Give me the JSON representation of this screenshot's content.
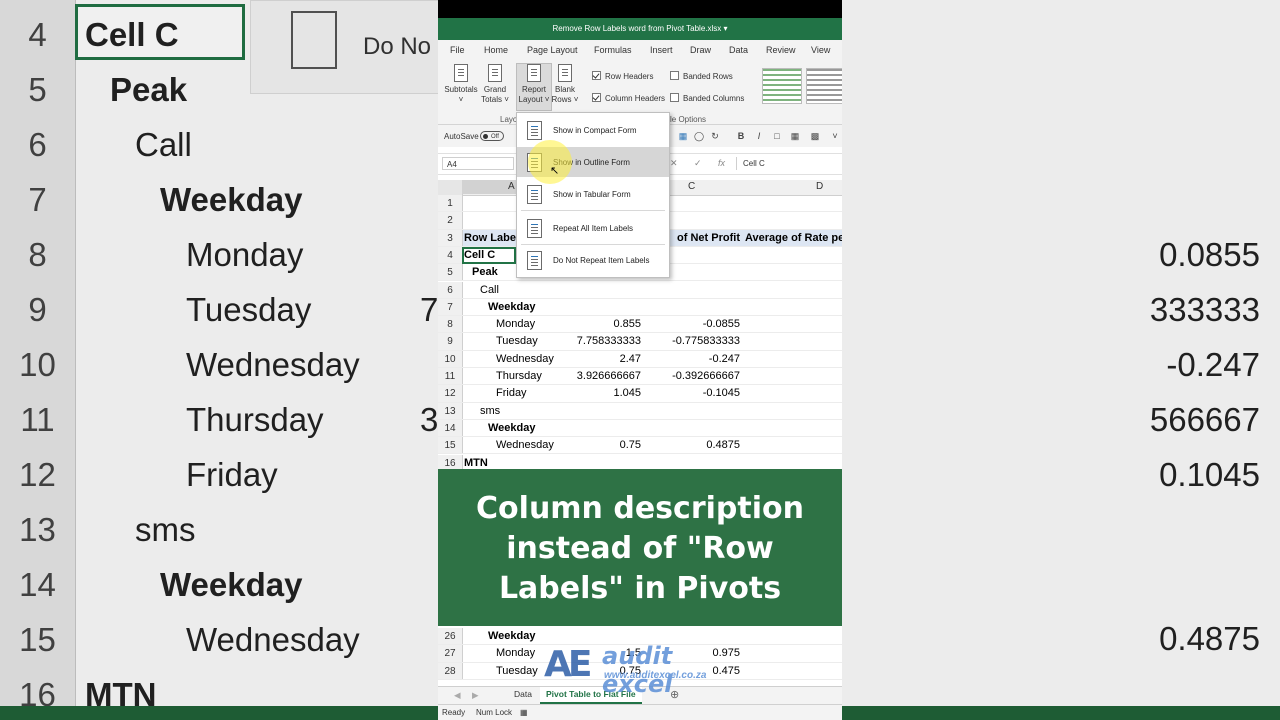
{
  "window": {
    "title": "Remove Row Labels word from Pivot Table.xlsx"
  },
  "menu_tabs": [
    "File",
    "Home",
    "Page Layout",
    "Formulas",
    "Insert",
    "Draw",
    "Data",
    "Review",
    "View"
  ],
  "ribbon": {
    "buttons": [
      {
        "label1": "Subtotals",
        "label2": ""
      },
      {
        "label1": "Grand",
        "label2": "Totals"
      },
      {
        "label1": "Report",
        "label2": "Layout"
      },
      {
        "label1": "Blank",
        "label2": "Rows"
      }
    ],
    "checkboxes": [
      {
        "label": "Row Headers",
        "checked": true
      },
      {
        "label": "Column Headers",
        "checked": true
      },
      {
        "label": "Banded Rows",
        "checked": false
      },
      {
        "label": "Banded Columns",
        "checked": false
      }
    ],
    "group_layout": "Layo",
    "group_style": "yle Options"
  },
  "qat": {
    "autosave_label": "AutoSave",
    "toggle_label": "Off"
  },
  "formula_bar": {
    "name_box": "A4",
    "formula": "Cell C"
  },
  "columns": [
    "A",
    "C",
    "D"
  ],
  "dropdown": {
    "items": [
      {
        "label": "Show in Compact Form"
      },
      {
        "label": "Show in Outline Form"
      },
      {
        "label": "Show in Tabular Form"
      },
      {
        "label": "Repeat All Item Labels"
      },
      {
        "label": "Do Not Repeat Item Labels"
      }
    ]
  },
  "grid": {
    "rows": [
      {
        "n": "1",
        "a": "",
        "b": "",
        "c": "",
        "d": ""
      },
      {
        "n": "2",
        "a": "",
        "b": "",
        "c": "",
        "d": ""
      },
      {
        "n": "3",
        "a": "Row Labe",
        "b": "",
        "c": "of Net Profit",
        "d": "Average of Rate pe"
      },
      {
        "n": "4",
        "a": "Cell C",
        "b": "",
        "c": "",
        "d": ""
      },
      {
        "n": "5",
        "a": "Peak",
        "b": "",
        "c": "",
        "d": ""
      },
      {
        "n": "6",
        "a": "Call",
        "b": "",
        "c": "",
        "d": ""
      },
      {
        "n": "7",
        "a": "Weekday",
        "b": "",
        "c": "",
        "d": ""
      },
      {
        "n": "8",
        "a": "Monday",
        "b": "0.855",
        "c": "-0.0855",
        "d": ""
      },
      {
        "n": "9",
        "a": "Tuesday",
        "b": "7.758333333",
        "c": "-0.775833333",
        "d": ""
      },
      {
        "n": "10",
        "a": "Wednesday",
        "b": "2.47",
        "c": "-0.247",
        "d": ""
      },
      {
        "n": "11",
        "a": "Thursday",
        "b": "3.926666667",
        "c": "-0.392666667",
        "d": ""
      },
      {
        "n": "12",
        "a": "Friday",
        "b": "1.045",
        "c": "-0.1045",
        "d": ""
      },
      {
        "n": "13",
        "a": "sms",
        "b": "",
        "c": "",
        "d": ""
      },
      {
        "n": "14",
        "a": "Weekday",
        "b": "",
        "c": "",
        "d": ""
      },
      {
        "n": "15",
        "a": "Wednesday",
        "b": "0.75",
        "c": "0.4875",
        "d": ""
      },
      {
        "n": "16",
        "a": "MTN",
        "b": "",
        "c": "",
        "d": ""
      }
    ],
    "rows_lower": [
      {
        "n": "26",
        "a": "Weekday",
        "b": "",
        "c": ""
      },
      {
        "n": "27",
        "a": "Monday",
        "b": "1.5",
        "c": "0.975"
      },
      {
        "n": "28",
        "a": "Tuesday",
        "b": "0.75",
        "c": "0.475"
      }
    ]
  },
  "banner": {
    "line1": "Column description",
    "line2": "instead of \"Row",
    "line3": "Labels\" in Pivots"
  },
  "logo": {
    "name": "audit excel",
    "url": "www.auditexcel.co.za"
  },
  "sheet_tabs": [
    "Data",
    "Pivot Table to Flat File"
  ],
  "status": {
    "ready": "Ready",
    "numlock": "Num Lock"
  },
  "background": {
    "left_rows": [
      {
        "n": "4",
        "t": "Cell C"
      },
      {
        "n": "5",
        "t": "Peak"
      },
      {
        "n": "6",
        "t": "Call"
      },
      {
        "n": "7",
        "t": "Weekday"
      },
      {
        "n": "8",
        "t": "Monday"
      },
      {
        "n": "9",
        "t": "Tuesday"
      },
      {
        "n": "10",
        "t": "Wednesday"
      },
      {
        "n": "11",
        "t": "Thursday"
      },
      {
        "n": "12",
        "t": "Friday"
      },
      {
        "n": "13",
        "t": "sms"
      },
      {
        "n": "14",
        "t": "Weekday"
      },
      {
        "n": "15",
        "t": "Wednesday"
      },
      {
        "n": "16",
        "t": "MTN"
      }
    ],
    "panel_text": "Do No",
    "right_values": [
      "0.0855",
      "333333",
      "-0.247",
      "566667",
      "0.1045",
      "0.4875"
    ],
    "left_partial": [
      "7",
      "3"
    ]
  },
  "colors": {
    "excel_green": "#217346",
    "banner_green": "#2e7245"
  }
}
